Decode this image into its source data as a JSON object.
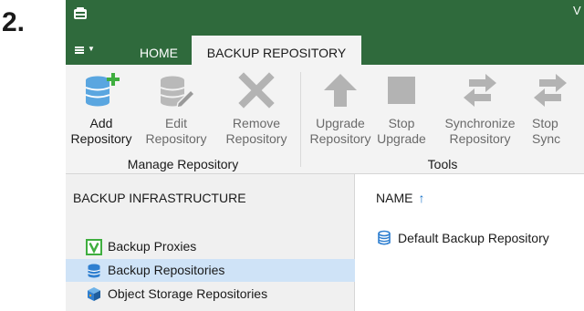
{
  "step_label": "2.",
  "titlebar": {
    "title_fragment": "V"
  },
  "tabs": [
    {
      "label": "HOME"
    },
    {
      "label": "BACKUP REPOSITORY"
    }
  ],
  "ribbon": {
    "groups": [
      {
        "label": "Manage Repository"
      },
      {
        "label": "Tools"
      }
    ],
    "buttons": [
      {
        "line1": "Add",
        "line2": "Repository",
        "icon": "add-repository-icon",
        "enabled": true
      },
      {
        "line1": "Edit",
        "line2": "Repository",
        "icon": "edit-repository-icon",
        "enabled": false
      },
      {
        "line1": "Remove",
        "line2": "Repository",
        "icon": "remove-icon",
        "enabled": false
      },
      {
        "line1": "Upgrade",
        "line2": "Repository",
        "icon": "upgrade-arrow-icon",
        "enabled": false
      },
      {
        "line1": "Stop",
        "line2": "Upgrade",
        "icon": "stop-icon",
        "enabled": false
      },
      {
        "line1": "Synchronize",
        "line2": "Repository",
        "icon": "synchronize-icon",
        "enabled": false
      },
      {
        "line1": "Stop",
        "line2": "Sync",
        "icon": "stop-sync-icon",
        "enabled": false
      }
    ]
  },
  "left_pane": {
    "header": "BACKUP INFRASTRUCTURE",
    "items": [
      {
        "label": "Backup Proxies",
        "icon": "backup-proxy-icon",
        "selected": false
      },
      {
        "label": "Backup Repositories",
        "icon": "database-icon",
        "selected": true
      },
      {
        "label": "Object Storage Repositories",
        "icon": "object-storage-icon",
        "selected": false
      }
    ]
  },
  "main_pane": {
    "column_header": "NAME",
    "sort_indicator": "↑",
    "rows": [
      {
        "name": "Default Backup Repository",
        "icon": "database-icon"
      }
    ]
  },
  "colors": {
    "title_green": "#2f6a3c",
    "ribbon_bg": "#f3f3f3",
    "selection_blue": "#cfe3f7",
    "sort_arrow_blue": "#1a73c9",
    "add_plus_green": "#3fae3f",
    "proxy_v_green": "#3fae3f"
  }
}
